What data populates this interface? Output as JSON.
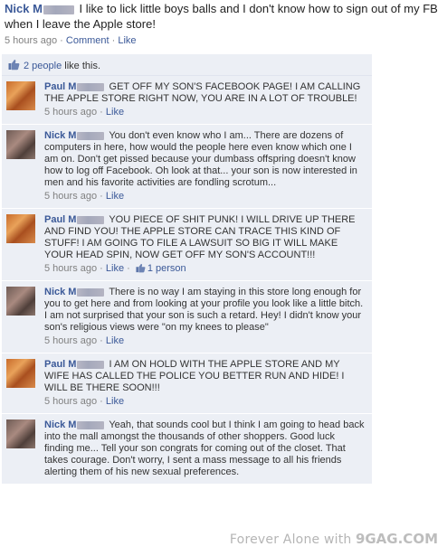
{
  "post": {
    "author": "Nick M",
    "text": "I like to lick little boys balls and I don't know how to sign out of my FB when I leave the Apple store!",
    "time": "5 hours ago",
    "comment_label": "Comment",
    "like_label": "Like",
    "sep": " · "
  },
  "likes": {
    "count_label": "2 people",
    "suffix": " like this."
  },
  "comments": [
    {
      "author": "Paul M",
      "text": "GET OFF MY SON'S FACEBOOK PAGE! I AM CALLING THE APPLE STORE RIGHT NOW, YOU ARE IN A LOT OF TROUBLE!",
      "time": "5 hours ago",
      "like_label": "Like"
    },
    {
      "author": "Nick M",
      "text": "You don't even know who I am... There are dozens of computers in here, how would the people here even know which one I am on. Don't get pissed because your dumbass offspring doesn't know how to log off Facebook. Oh look at that... your son is now interested in men and his favorite activities are fondling scrotum...",
      "time": "5 hours ago",
      "like_label": "Like"
    },
    {
      "author": "Paul M",
      "text": "YOU PIECE OF SHIT PUNK! I WILL DRIVE UP THERE AND FIND YOU! THE APPLE STORE CAN TRACE THIS KIND OF STUFF! I AM GOING TO FILE A LAWSUIT SO BIG IT WILL MAKE YOUR HEAD SPIN, NOW GET OFF MY SON'S ACCOUNT!!!",
      "time": "5 hours ago",
      "like_label": "Like",
      "likes": "1 person"
    },
    {
      "author": "Nick M",
      "text": "There is no way I am staying in this store long enough for you to get here and from looking at your profile you look like a little bitch. I am not surprised that your son is such a retard. Hey! I didn't know your son's religious views were \"on my knees to please\"",
      "time": "5 hours ago",
      "like_label": "Like"
    },
    {
      "author": "Paul M",
      "text": "I AM ON HOLD WITH THE APPLE STORE AND MY WIFE HAS CALLED THE POLICE YOU BETTER RUN AND HIDE! I WILL BE THERE SOON!!!",
      "time": "5 hours ago",
      "like_label": "Like"
    },
    {
      "author": "Nick M",
      "text": "Yeah, that sounds cool but I think I am going to head back into the mall amongst the thousands of other shoppers. Good luck finding me... Tell your son congrats for coming out of the closet. That takes courage. Don't worry, I sent a mass message to all his friends alerting them of his new sexual preferences.",
      "time": "",
      "like_label": ""
    }
  ],
  "watermark": {
    "phrase": "Forever Alone with",
    "brand": "9GAG.COM"
  },
  "colors": {
    "link": "#3b5998",
    "comment_bg": "#eceff5",
    "meta": "#808080"
  }
}
